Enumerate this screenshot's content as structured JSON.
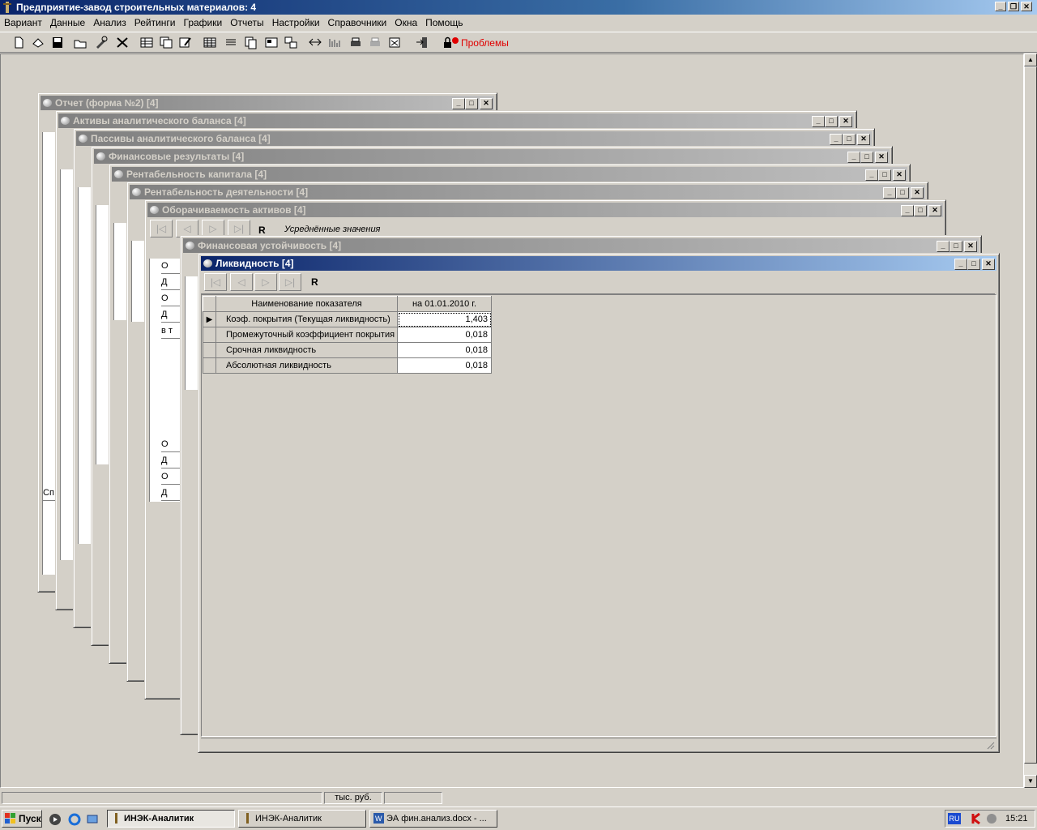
{
  "app": {
    "title": "Предприятие-завод строительных материалов: 4"
  },
  "menu": [
    "Вариант",
    "Данные",
    "Анализ",
    "Рейтинги",
    "Графики",
    "Отчеты",
    "Настройки",
    "Справочники",
    "Окна",
    "Помощь"
  ],
  "toolbar": {
    "problems_label": "Проблемы"
  },
  "windows": [
    {
      "title": "Отчет (форма №2) [4]"
    },
    {
      "title": "Активы аналитического баланса [4]"
    },
    {
      "title": "Пассивы аналитического баланса [4]"
    },
    {
      "title": "Финансовые результаты [4]"
    },
    {
      "title": "Рентабельность капитала [4]"
    },
    {
      "title": "Рентабельность деятельности [4]"
    },
    {
      "title": "Оборачиваемость активов [4]"
    },
    {
      "title": "Финансовая устойчивость [4]"
    },
    {
      "title": "Ликвидность [4]"
    }
  ],
  "turnover": {
    "r_label": "R",
    "avg_label": "Усреднённые значения"
  },
  "partial_texts": {
    "form2_row": "Сп",
    "turnover_rows": [
      "О",
      "Д",
      "О",
      "Д",
      "в т",
      "О",
      "Д",
      "О",
      "Д"
    ]
  },
  "liquidity": {
    "r_label": "R",
    "columns": [
      "Наименование показателя",
      "на 01.01.2010 г."
    ],
    "rows": [
      {
        "name": "Коэф. покрытия (Текущая ликвидность)",
        "value": "1,403"
      },
      {
        "name": "Промежуточный коэффициент покрытия",
        "value": "0,018"
      },
      {
        "name": "Срочная ликвидность",
        "value": "0,018"
      },
      {
        "name": "Абсолютная ликвидность",
        "value": "0,018"
      }
    ]
  },
  "status": {
    "units": "тыс. руб."
  },
  "taskbar": {
    "start_label": "Пуск",
    "tasks": [
      "ИНЭК-Аналитик",
      "ИНЭК-Аналитик",
      "ЭА фин.анализ.docx - ..."
    ],
    "lang": "RU",
    "clock": "15:21"
  }
}
